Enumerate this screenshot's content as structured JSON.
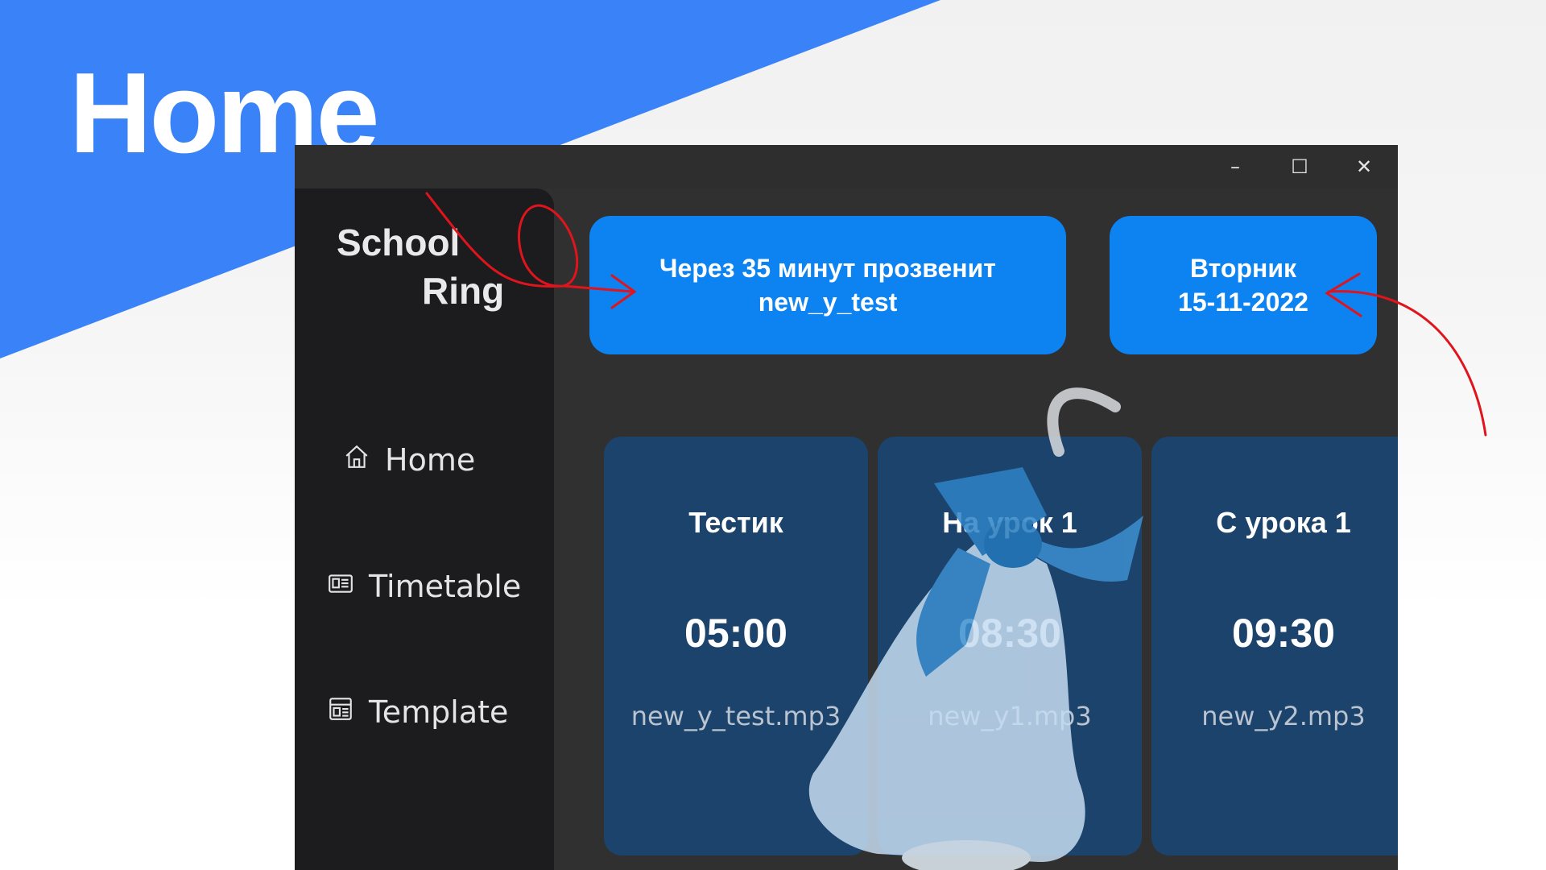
{
  "hero": {
    "title": "Home",
    "banner_color": "#3a82f7"
  },
  "window": {
    "controls": {
      "minimize": "–",
      "maximize": "☐",
      "close": "✕"
    }
  },
  "sidebar": {
    "logo_line1": "School",
    "logo_line2": "Ring",
    "items": [
      {
        "label": "Home",
        "icon": "home-icon"
      },
      {
        "label": "Timetable",
        "icon": "timetable-icon"
      },
      {
        "label": "Template",
        "icon": "template-icon"
      }
    ]
  },
  "info": {
    "next_ring_line1": "Через 35 минут прозвенит",
    "next_ring_line2": "new_y_test",
    "day": "Вторник",
    "date": "15-11-2022",
    "card_color": "#0d82f1"
  },
  "bells": [
    {
      "name": "Тестик",
      "time": "05:00",
      "file": "new_y_test.mp3"
    },
    {
      "name": "На урок 1",
      "time": "08:30",
      "file": "new_y1.mp3"
    },
    {
      "name": "С урока 1",
      "time": "09:30",
      "file": "new_y2.mp3"
    }
  ],
  "colors": {
    "bell_card": "#1c436c",
    "annotation": "#e0141d"
  }
}
